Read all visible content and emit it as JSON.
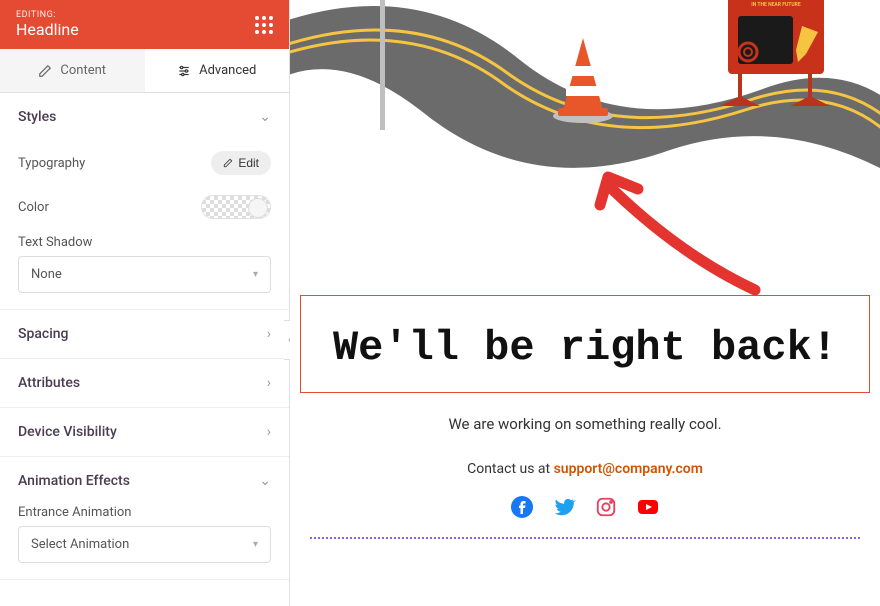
{
  "header": {
    "editing_label": "EDITING:",
    "title": "Headline"
  },
  "tabs": {
    "content": "Content",
    "advanced": "Advanced"
  },
  "sections": {
    "styles": {
      "title": "Styles",
      "typography_label": "Typography",
      "edit_label": "Edit",
      "color_label": "Color",
      "text_shadow_label": "Text Shadow",
      "text_shadow_value": "None"
    },
    "spacing": "Spacing",
    "attributes": "Attributes",
    "device_visibility": "Device Visibility",
    "animation": {
      "title": "Animation Effects",
      "entrance_label": "Entrance Animation",
      "entrance_value": "Select Animation"
    }
  },
  "preview": {
    "headline": "We'll be right back!",
    "subtext": "We are working on something really cool.",
    "contact_prefix": "Contact us at ",
    "contact_email": "support@company.com",
    "sign_text": "IN THE NEAR FUTURE"
  },
  "colors": {
    "brand": "#e44b32",
    "accent": "#d35400",
    "facebook": "#1877f2",
    "twitter": "#1da1f2",
    "instagram": "#e4405f",
    "youtube": "#ff0000"
  }
}
